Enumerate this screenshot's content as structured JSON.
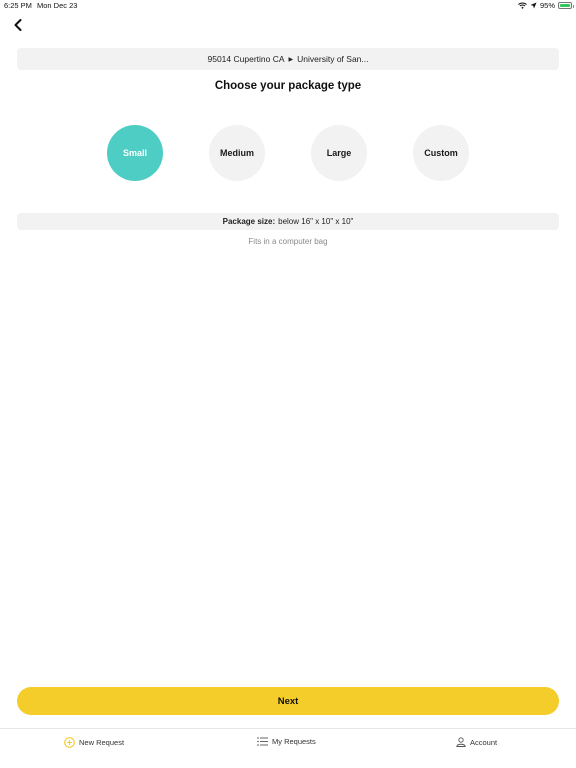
{
  "status_bar": {
    "time": "6:25 PM",
    "date": "Mon Dec 23",
    "battery": "95%",
    "battery_level": 0.95
  },
  "route": {
    "from": "95014  Cupertino CA",
    "to": "University of San..."
  },
  "title": "Choose your package type",
  "package_options": [
    {
      "label": "Small",
      "selected": true
    },
    {
      "label": "Medium",
      "selected": false
    },
    {
      "label": "Large",
      "selected": false
    },
    {
      "label": "Custom",
      "selected": false
    }
  ],
  "package_size": {
    "label": "Package size:",
    "value": "below 16\" x 10\" x 10\""
  },
  "size_hint": "Fits in a computer bag",
  "next_label": "Next",
  "tabs": [
    {
      "label": "New Request",
      "icon": "plus-circle-icon"
    },
    {
      "label": "My Requests",
      "icon": "list-icon"
    },
    {
      "label": "Account",
      "icon": "person-icon"
    }
  ],
  "colors": {
    "accent_teal": "#4ecdc4",
    "accent_yellow": "#f4cd2a",
    "option_gray": "#f2f2f2"
  }
}
